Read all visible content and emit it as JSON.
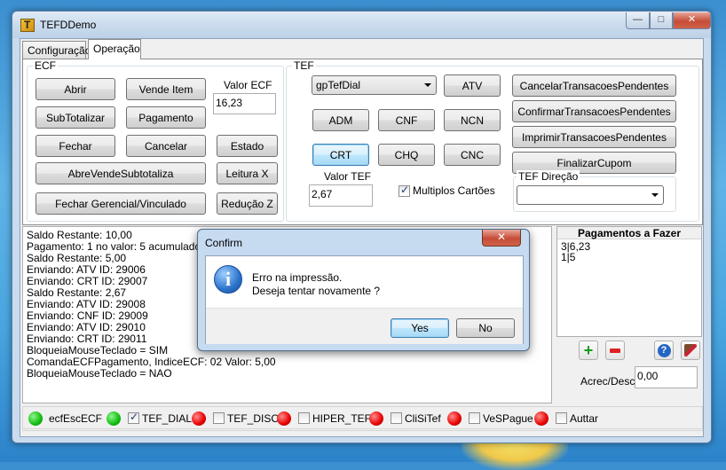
{
  "window": {
    "title": "TEFDDemo",
    "minimize": "—",
    "maximize": "□",
    "close": "✕"
  },
  "tabs": [
    {
      "label": "Configuração"
    },
    {
      "label": "Operação"
    }
  ],
  "ecf": {
    "group_label": "ECF",
    "abrir": "Abrir",
    "vende_item": "Vende Item",
    "valor_label": "Valor ECF",
    "valor_value": "16,23",
    "subtotalizar": "SubTotalizar",
    "pagamento": "Pagamento",
    "fechar": "Fechar",
    "cancelar": "Cancelar",
    "estado": "Estado",
    "abre_vende": "AbreVendeSubtotaliza",
    "leitura_x": "Leitura X",
    "fechar_gerencial": "Fechar Gerencial/Vinculado",
    "reducao_z": "Redução Z"
  },
  "tef": {
    "group_label": "TEF",
    "gp_selected": "gpTefDial",
    "atv": "ATV",
    "adm": "ADM",
    "cnf": "CNF",
    "ncn": "NCN",
    "crt": "CRT",
    "chq": "CHQ",
    "cnc": "CNC",
    "valor_label": "Valor TEF",
    "valor_value": "2,67",
    "multiplos_cartoes": "Multiplos Cartões",
    "multiplos_checked": true,
    "cancelar_pend": "CancelarTransacoesPendentes",
    "confirmar_pend": "ConfirmarTransacoesPendentes",
    "imprimir_pend": "ImprimirTransacoesPendentes",
    "finalizar_cupom": "FinalizarCupom",
    "direcao_label": "TEF Direção",
    "direcao_value": ""
  },
  "log_lines": [
    "Saldo Restante: 10,00",
    "Pagamento: 1 no valor: 5 acumulado",
    "Saldo Restante: 5,00",
    "Enviando: ATV ID: 29006",
    "Enviando: CRT ID: 29007",
    "Saldo Restante: 2,67",
    "Enviando: ATV ID: 29008",
    "Enviando: CNF ID: 29009",
    "Enviando: ATV ID: 29010",
    "Enviando: CRT ID: 29011",
    "BloqueiaMouseTeclado = SIM",
    "ComandaECFPagamento, IndiceECF: 02 Valor: 5,00",
    "BloqueiaMouseTeclado = NAO"
  ],
  "payments": {
    "header": "Pagamentos a Fazer",
    "lines": [
      "3|6,23",
      "1|5"
    ],
    "acrec_label": "Acrec/Desc",
    "acrec_value": "0,00"
  },
  "status": [
    {
      "label": "ecfEscECF",
      "led": "green",
      "has_checkbox": false,
      "checked": false
    },
    {
      "label": "TEF_DIAL",
      "led": "green",
      "has_checkbox": true,
      "checked": true
    },
    {
      "label": "TEF_DISC",
      "led": "red",
      "has_checkbox": true,
      "checked": false
    },
    {
      "label": "HIPER_TEF",
      "led": "red",
      "has_checkbox": true,
      "checked": false
    },
    {
      "label": "CliSiTef",
      "led": "red",
      "has_checkbox": true,
      "checked": false
    },
    {
      "label": "VeSPague",
      "led": "red",
      "has_checkbox": true,
      "checked": false
    },
    {
      "label": "Auttar",
      "led": "red",
      "has_checkbox": true,
      "checked": false
    }
  ],
  "dialog": {
    "title": "Confirm",
    "close": "✕",
    "line1": "Erro na impressão.",
    "line2": "Deseja tentar novamente ?",
    "yes": "Yes",
    "no": "No",
    "icon": "info-icon"
  },
  "colors": {
    "led_green": "#0fbe0f",
    "led_red": "#e80000",
    "close_red": "#c64d37"
  }
}
